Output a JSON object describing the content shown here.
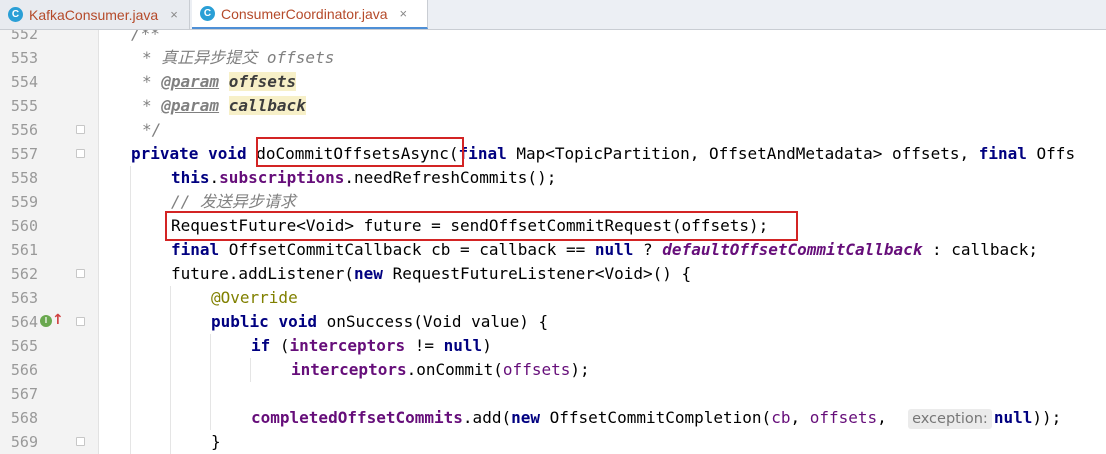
{
  "tabs": [
    {
      "label": "KafkaConsumer.java",
      "icon": "C",
      "close": "×"
    },
    {
      "label": "ConsumerCoordinator.java",
      "icon": "C",
      "close": "×"
    }
  ],
  "lines": [
    {
      "num": "552",
      "text": "/**"
    },
    {
      "num": "553",
      "comment_prefix": "* ",
      "text": "真正异步提交 offsets"
    },
    {
      "num": "554",
      "comment_prefix": "* ",
      "tag": "@param",
      "param": "offsets"
    },
    {
      "num": "555",
      "comment_prefix": "* ",
      "tag": "@param",
      "param": "callback"
    },
    {
      "num": "556",
      "text": "*/"
    },
    {
      "num": "557",
      "kw1": "private",
      "kw2": "void",
      "method": "doCommitOffsetsAsync",
      "open": "(",
      "kw3": "final",
      "rest1": " Map<TopicPartition, OffsetAndMetadata> offsets, ",
      "kw4": "final",
      "rest2": " Offs"
    },
    {
      "num": "558",
      "kw": "this",
      "dot": ".",
      "field": "subscriptions",
      "rest": ".needRefreshCommits();"
    },
    {
      "num": "559",
      "text": "// 发送异步请求"
    },
    {
      "num": "560",
      "text": "RequestFuture<Void> future = sendOffsetCommitRequest(offsets);"
    },
    {
      "num": "561",
      "kw": "final",
      "mid": " OffsetCommitCallback cb = callback == ",
      "kw2": "null",
      "q": " ? ",
      "field": "defaultOffsetCommitCallback",
      "rest": " : callback;"
    },
    {
      "num": "562",
      "pre": "future.addListener(",
      "kw": "new",
      "rest": " RequestFutureListener<Void>() {"
    },
    {
      "num": "563",
      "text": "@Override"
    },
    {
      "num": "564",
      "kw1": "public",
      "kw2": "void",
      "rest": " onSuccess(Void value) {"
    },
    {
      "num": "565",
      "kw": "if",
      "open": " (",
      "field": "interceptors",
      "mid": " != ",
      "kw2": "null",
      "close": ")"
    },
    {
      "num": "566",
      "field": "interceptors",
      "rest": ".onCommit(",
      "param": "offsets",
      "end": ");"
    },
    {
      "num": "567",
      "text": ""
    },
    {
      "num": "568",
      "field": "completedOffsetCommits",
      "pre": ".add(",
      "kw": "new",
      "mid": " OffsetCommitCompletion(",
      "p1": "cb",
      "c1": ", ",
      "p2": "offsets",
      "c2": ",  ",
      "hint": "exception:",
      "kw2": "null",
      "end": "));"
    },
    {
      "num": "569",
      "text": "}"
    }
  ],
  "gutter_markers": {
    "line_564": {
      "icon": "I",
      "arrow": "↑"
    }
  }
}
